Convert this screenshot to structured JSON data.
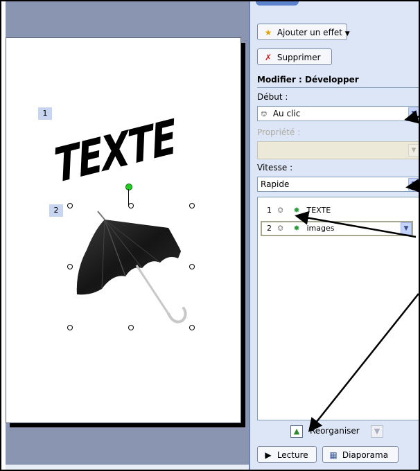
{
  "slide": {
    "tag1": "1",
    "tag2": "2",
    "wordart": "TEXTE"
  },
  "pane": {
    "add_effect": "Ajouter un effet",
    "delete": "Supprimer",
    "modify_heading": "Modifier : Développer",
    "start_label": "Début :",
    "start_value": "Au clic",
    "property_label": "Propriété :",
    "property_value": "",
    "speed_label": "Vitesse :",
    "speed_value": "Rapide",
    "effects": [
      {
        "num": "1",
        "name": "TEXTE"
      },
      {
        "num": "2",
        "name": "images"
      }
    ],
    "reorder_label": "Réorganiser",
    "play": "Lecture",
    "slideshow": "Diaporama"
  },
  "icons": {
    "add_effect": "star-icon",
    "delete": "delete-icon",
    "trigger": "mouse-icon",
    "effect": "entrance-star-icon",
    "move_up": "arrow-up-icon",
    "move_down": "arrow-down-icon",
    "play": "play-icon",
    "slideshow": "slideshow-icon"
  },
  "colors": {
    "pane_bg": "#dde6f6",
    "workspace_bg": "#8a96b1",
    "tag_bg": "#c8d5f0",
    "dropdown_arrow_bg": "#c3d3fd"
  }
}
